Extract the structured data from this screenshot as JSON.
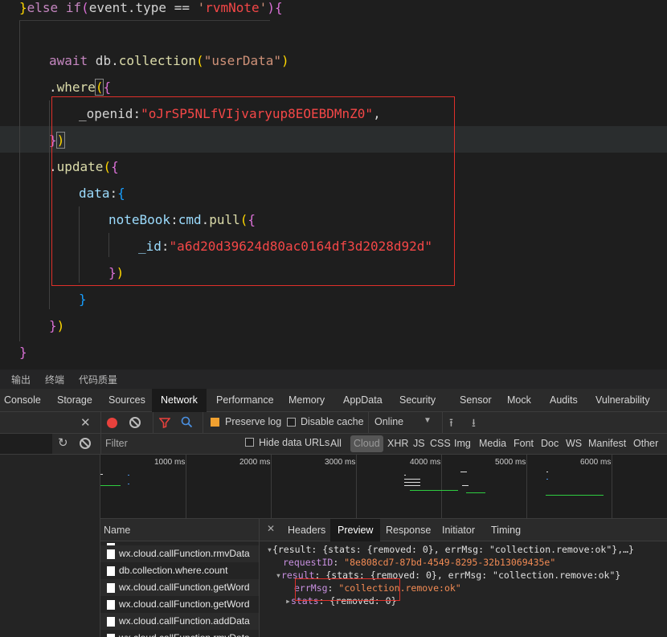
{
  "editor": {
    "line1": {
      "close": "}",
      "else_kw": "else",
      "if_kw": "if",
      "cond_open": "(",
      "event": "event",
      "dot1": ".",
      "type": "type",
      "op": " == ",
      "q1": "'",
      "rvmnote": "rvmNote",
      "q2": "'",
      "cond_close": ")",
      "block_open": "{"
    },
    "line3": {
      "await": "await",
      "db": " db",
      "dot": ".",
      "collection": "collection",
      "po": "(",
      "str": "\"userData\"",
      "pc": ")"
    },
    "line4": {
      "dot": ".",
      "where": "where",
      "po": "(",
      "bo": "{"
    },
    "line5": {
      "key": "_openid",
      "colon": ":",
      "str": "\"oJrSP5NLfVIjvaryup8EOEBDMnZ0\"",
      "comma": ","
    },
    "line6": {
      "bc": "}",
      "pc": ")"
    },
    "line7": {
      "dot": ".",
      "update": "update",
      "po": "(",
      "bo": "{"
    },
    "line8": {
      "key": "data",
      "colon": ":",
      "bo": "{"
    },
    "line9": {
      "key": "noteBook",
      "colon": ":",
      "cmd": "cmd",
      "dot": ".",
      "pull": "pull",
      "po": "(",
      "bo": "{"
    },
    "line10": {
      "key": "_id",
      "colon": ":",
      "str": "\"a6d20d39624d80ac0164df3d2028d92d\""
    },
    "line11": {
      "bc": "}",
      "pc": ")"
    },
    "line12": {
      "bc": "}"
    },
    "line13": {
      "bc": "}",
      "pc": ")"
    },
    "line14": {
      "bc": "}"
    }
  },
  "bottom_panel": {
    "output": "输出",
    "terminal": "终端",
    "quality": "代码质量"
  },
  "devtools": {
    "tabs": [
      "Console",
      "Storage",
      "Sources",
      "Network",
      "Performance",
      "Memory",
      "AppData",
      "Security",
      "Sensor",
      "Mock",
      "Audits",
      "Vulnerability"
    ],
    "toolbar": {
      "preserve_log": "Preserve log",
      "disable_cache": "Disable cache",
      "throttle": "Online"
    },
    "filter": {
      "placeholder": "Filter",
      "hide_data_urls": "Hide data URLs",
      "types": [
        "All",
        "Cloud",
        "XHR",
        "JS",
        "CSS",
        "Img",
        "Media",
        "Font",
        "Doc",
        "WS",
        "Manifest",
        "Other"
      ]
    },
    "timeline": {
      "ticks": [
        "1000 ms",
        "2000 ms",
        "3000 ms",
        "4000 ms",
        "5000 ms",
        "6000 ms"
      ]
    },
    "name_header": "Name",
    "requests": [
      "wx.cloud.callFunction.rmvData",
      "db.collection.where.count",
      "wx.cloud.callFunction.getWord",
      "wx.cloud.callFunction.getWord",
      "wx.cloud.callFunction.addData",
      "wx.cloud.callFunction.rmvData"
    ],
    "detail_tabs": [
      "Headers",
      "Preview",
      "Response",
      "Initiator",
      "Timing"
    ],
    "preview": {
      "line1": "{result: {stats: {removed: 0}, errMsg: \"collection.remove:ok\"},…}",
      "request_key": "requestID",
      "request_val": "\"8e808cd7-87bd-4549-8295-32b13069435e\"",
      "result_key": "result",
      "result_val": "{stats: {removed: 0}, errMsg: \"collection.remove:ok\"}",
      "errmsg_key": "errMsg",
      "errmsg_val": "\"collection.remove:ok\"",
      "stats_key": "stats",
      "stats_val": "{removed: 0}"
    }
  },
  "colors": {
    "string": "#ce9178",
    "string_red": "#f44747",
    "keyword": "#569cd6",
    "function": "#dcdcaa",
    "highlight_box": "#e0302a"
  }
}
